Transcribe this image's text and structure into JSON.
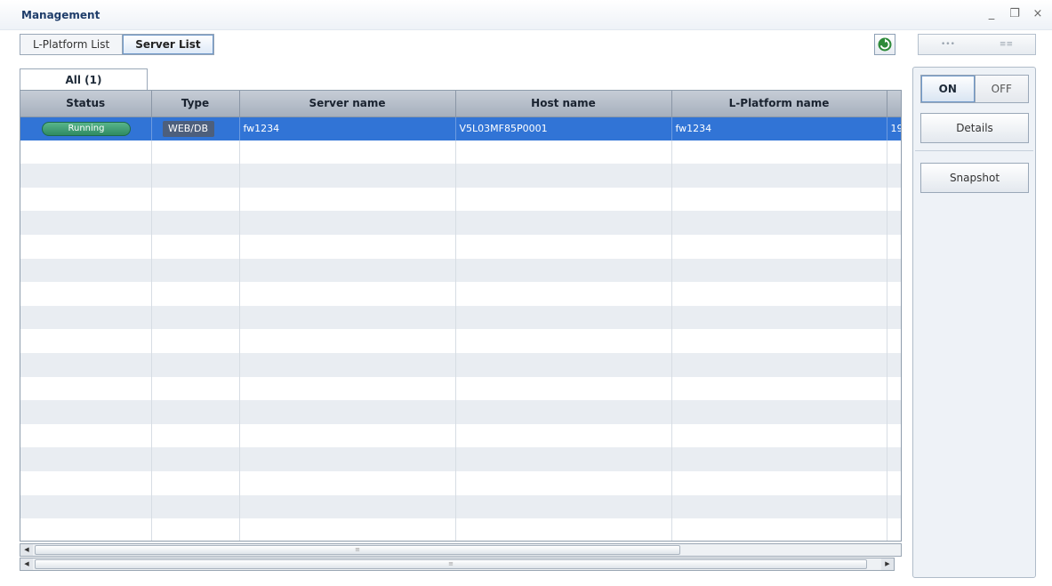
{
  "window": {
    "title": "Management",
    "controls": [
      "_",
      "❐",
      "×"
    ]
  },
  "tabs": [
    {
      "label": "L-Platform List",
      "active": false
    },
    {
      "label": "Server List",
      "active": true
    }
  ],
  "top_right_button": {
    "left_glyph": "•••",
    "right_glyph": "≡≡"
  },
  "list_tab": {
    "label": "All (1)"
  },
  "table": {
    "columns": [
      "Status",
      "Type",
      "Server name",
      "Host name",
      "L-Platform name",
      ""
    ],
    "rows": [
      {
        "status": "Running",
        "type": "WEB/DB",
        "server_name": "fw1234",
        "host_name": "V5L03MF85P0001",
        "lplatform_name": "fw1234",
        "extra": "19"
      }
    ]
  },
  "scrollbars": {
    "inner_thumb_glyph": "≡",
    "outer_thumb_glyph": "≡"
  },
  "side_panel": {
    "toggle_on": "ON",
    "toggle_off": "OFF",
    "details_button": "Details",
    "snapshot_button": "Snapshot"
  },
  "colors": {
    "selection": "#3174d6",
    "status_running": "#3a9a6e",
    "type_badge": "#4d5f7c",
    "refresh_icon": "#2e8b3a"
  }
}
